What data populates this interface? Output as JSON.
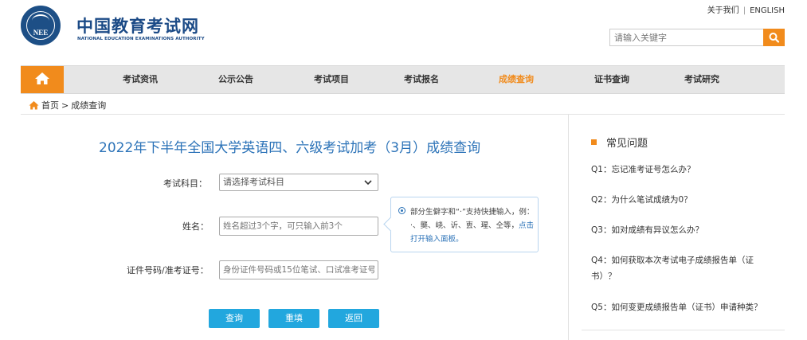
{
  "header": {
    "logo_text": "NEE",
    "site_name_cn": "中国教育考试网",
    "site_name_en": "NATIONAL EDUCATION EXAMINATIONS AUTHORITY",
    "top_links": [
      "关于我们",
      "ENGLISH"
    ],
    "search": {
      "placeholder": "请输入关键字",
      "icon": "search-icon"
    }
  },
  "nav": {
    "home_icon": "home-icon",
    "items": [
      "考试资讯",
      "公示公告",
      "考试项目",
      "考试报名",
      "成绩查询",
      "证书查询",
      "考试研究"
    ],
    "active": "成绩查询"
  },
  "breadcrumb": {
    "home": "首页",
    "separator": ">",
    "current": "成绩查询"
  },
  "form": {
    "title": "2022年下半年全国大学英语四、六级考试加考（3月）成绩查询",
    "subject_label": "考试科目：",
    "subject_value": "请选择考试科目",
    "name_label": "姓名：",
    "name_placeholder": "姓名超过3个字，可只输入前3个",
    "id_label": "证件号码/准考证号：",
    "id_placeholder": "身份证件号码或15位笔试、口试准考证号",
    "tip_text": "部分生僻字和“·”支持快捷输入，例：·、龑、峣、䜣、叀、瑆、仝等，",
    "tip_link": "点击打开输入面板。",
    "buttons": {
      "query": "查询",
      "reset": "重填",
      "back": "返回"
    }
  },
  "faq": {
    "heading": "常见问题",
    "items": [
      "Q1：忘记准考证号怎么办？",
      "Q2：为什么笔试成绩为0？",
      "Q3：如对成绩有异议怎么办？",
      "Q4：如何获取本次考试电子成绩报告单（证书）？",
      "Q5：如何变更成绩报告单（证书）申请种类？"
    ]
  },
  "colors": {
    "accent": "#f18b1c",
    "brand": "#1b4a86",
    "link": "#2c73b8",
    "button": "#22a7de"
  }
}
